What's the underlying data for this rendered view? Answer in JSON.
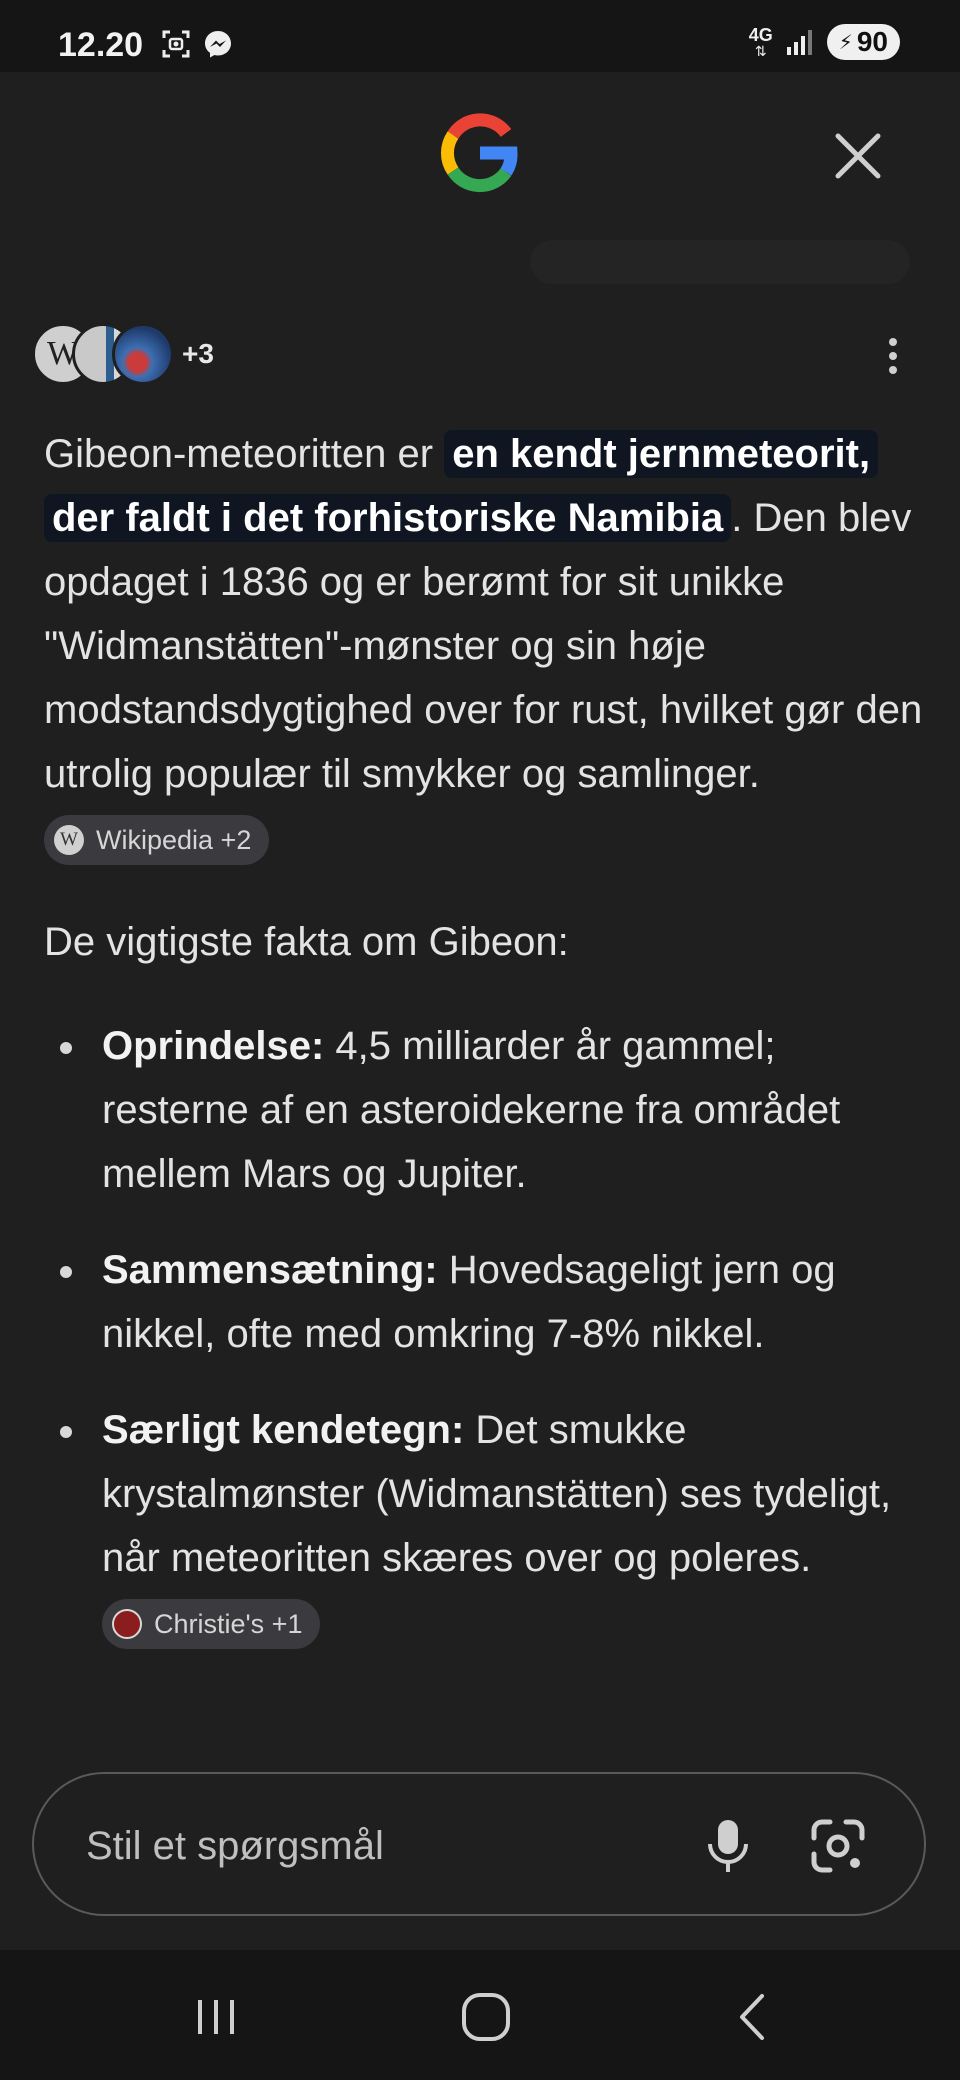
{
  "status_bar": {
    "time": "12.20",
    "network": "4G",
    "battery": "90",
    "icons_left": [
      "screenshot-icon",
      "messenger-icon"
    ],
    "icons_right": [
      "data-arrows-icon",
      "signal-icon",
      "battery-icon"
    ]
  },
  "header": {
    "logo_icon": "google-g-icon",
    "close_icon": "close-icon"
  },
  "sources": {
    "avatars": [
      "wikipedia",
      "document",
      "photo"
    ],
    "more_count": "+3"
  },
  "answer": {
    "intro_plain": "Gibeon-meteoritten er ",
    "intro_highlight": "en kendt jernmeteorit, der faldt i det forhistoriske Namibia",
    "intro_rest": ". Den blev opdaget i 1836 og er berømt for sit unikke \"Widmanstätten\"-mønster og sin høje modstandsdygtighed over for rust, hvilket gør den utrolig populær til smykker og samlinger.",
    "intro_chip": "Wikipedia +2",
    "facts_title": "De vigtigste fakta om Gibeon:",
    "facts": [
      {
        "label": "Oprindelse:",
        "text": " 4,5 milliarder år gammel; resterne af en asteroidekerne fra området mellem Mars og Jupiter."
      },
      {
        "label": "Sammensætning:",
        "text": " Hovedsageligt jern og nikkel, ofte med omkring 7-8% nikkel."
      },
      {
        "label": "Særligt kendetegn:",
        "text": " Det smukke krystalmønster (Widmanstätten) ses tydeligt, når meteoritten skæres over og poleres."
      }
    ],
    "last_chip": "Christie's +1"
  },
  "ask": {
    "placeholder": "Stil et spørgsmål"
  },
  "colors": {
    "background": "#1f1f1f",
    "highlight_bg": "#0f1521",
    "chip_bg": "#3a3a3f",
    "google_blue": "#4285F4",
    "google_red": "#EA4335",
    "google_yellow": "#FBBC05",
    "google_green": "#34A853"
  }
}
